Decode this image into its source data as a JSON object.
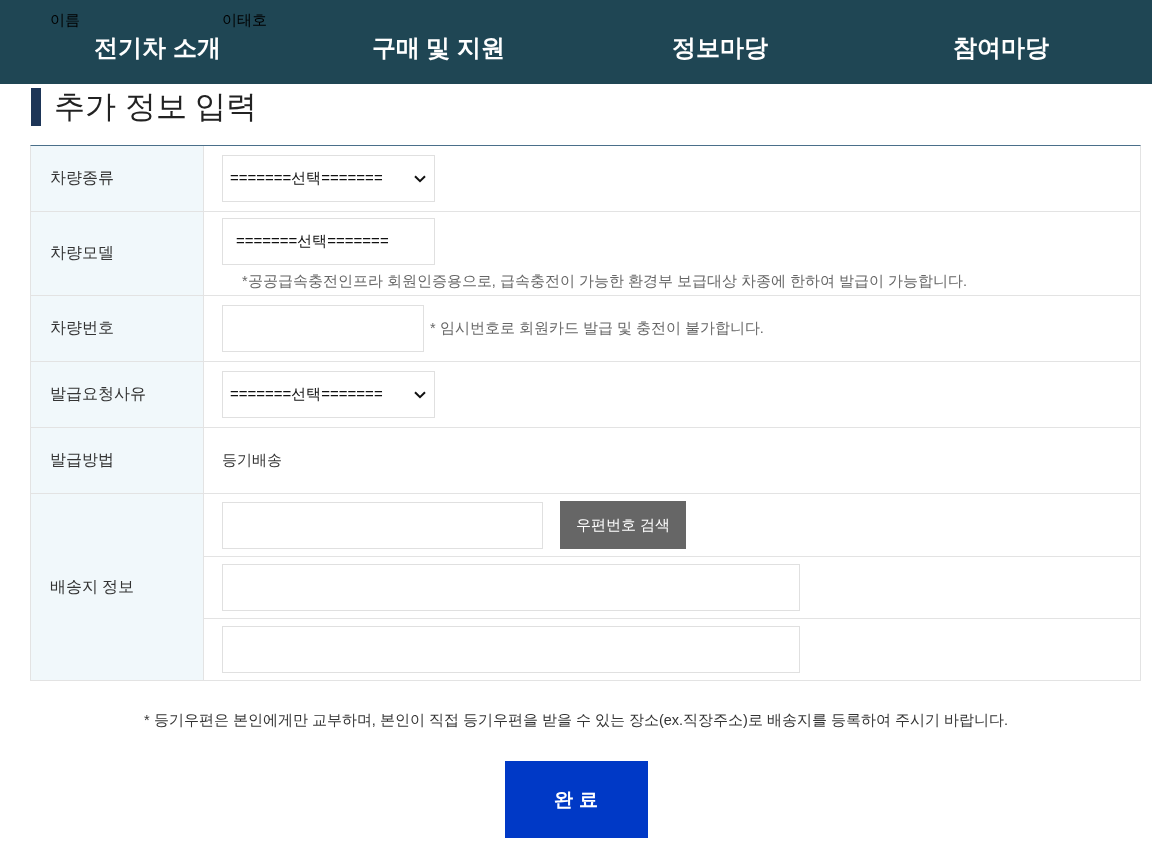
{
  "background_row": {
    "label": "이름",
    "value": "이태호"
  },
  "nav": {
    "items": [
      "전기차 소개",
      "구매 및 지원",
      "정보마당",
      "참여마당"
    ]
  },
  "section_title": "추가 정보 입력",
  "form": {
    "rows": [
      {
        "label": "차량종류",
        "kind": "select",
        "value": "=======선택======="
      },
      {
        "label": "차량모델",
        "kind": "box",
        "value": "=======선택=======",
        "note": "*공공급속충전인프라 회원인증용으로, 급속충전이 가능한 환경부 보급대상 차종에 한하여 발급이 가능합니다."
      },
      {
        "label": "차량번호",
        "kind": "input",
        "note": "* 임시번호로 회원카드 발급 및 충전이 불가합니다."
      },
      {
        "label": "발급요청사유",
        "kind": "select",
        "value": "=======선택======="
      },
      {
        "label": "발급방법",
        "kind": "text",
        "value": "등기배송"
      },
      {
        "label": "배송지 정보",
        "kind": "address",
        "fields": [
          {
            "kind": "postcode",
            "button": "우편번호 검색"
          },
          {
            "kind": "line"
          },
          {
            "kind": "line"
          }
        ]
      }
    ]
  },
  "footer_note": "* 등기우편은 본인에게만 교부하며, 본인이 직접 등기우편을 받을 수 있는 장소(ex.직장주소)로 배송지를 등록하여 주시기 바랍니다.",
  "submit_button": "완 료"
}
